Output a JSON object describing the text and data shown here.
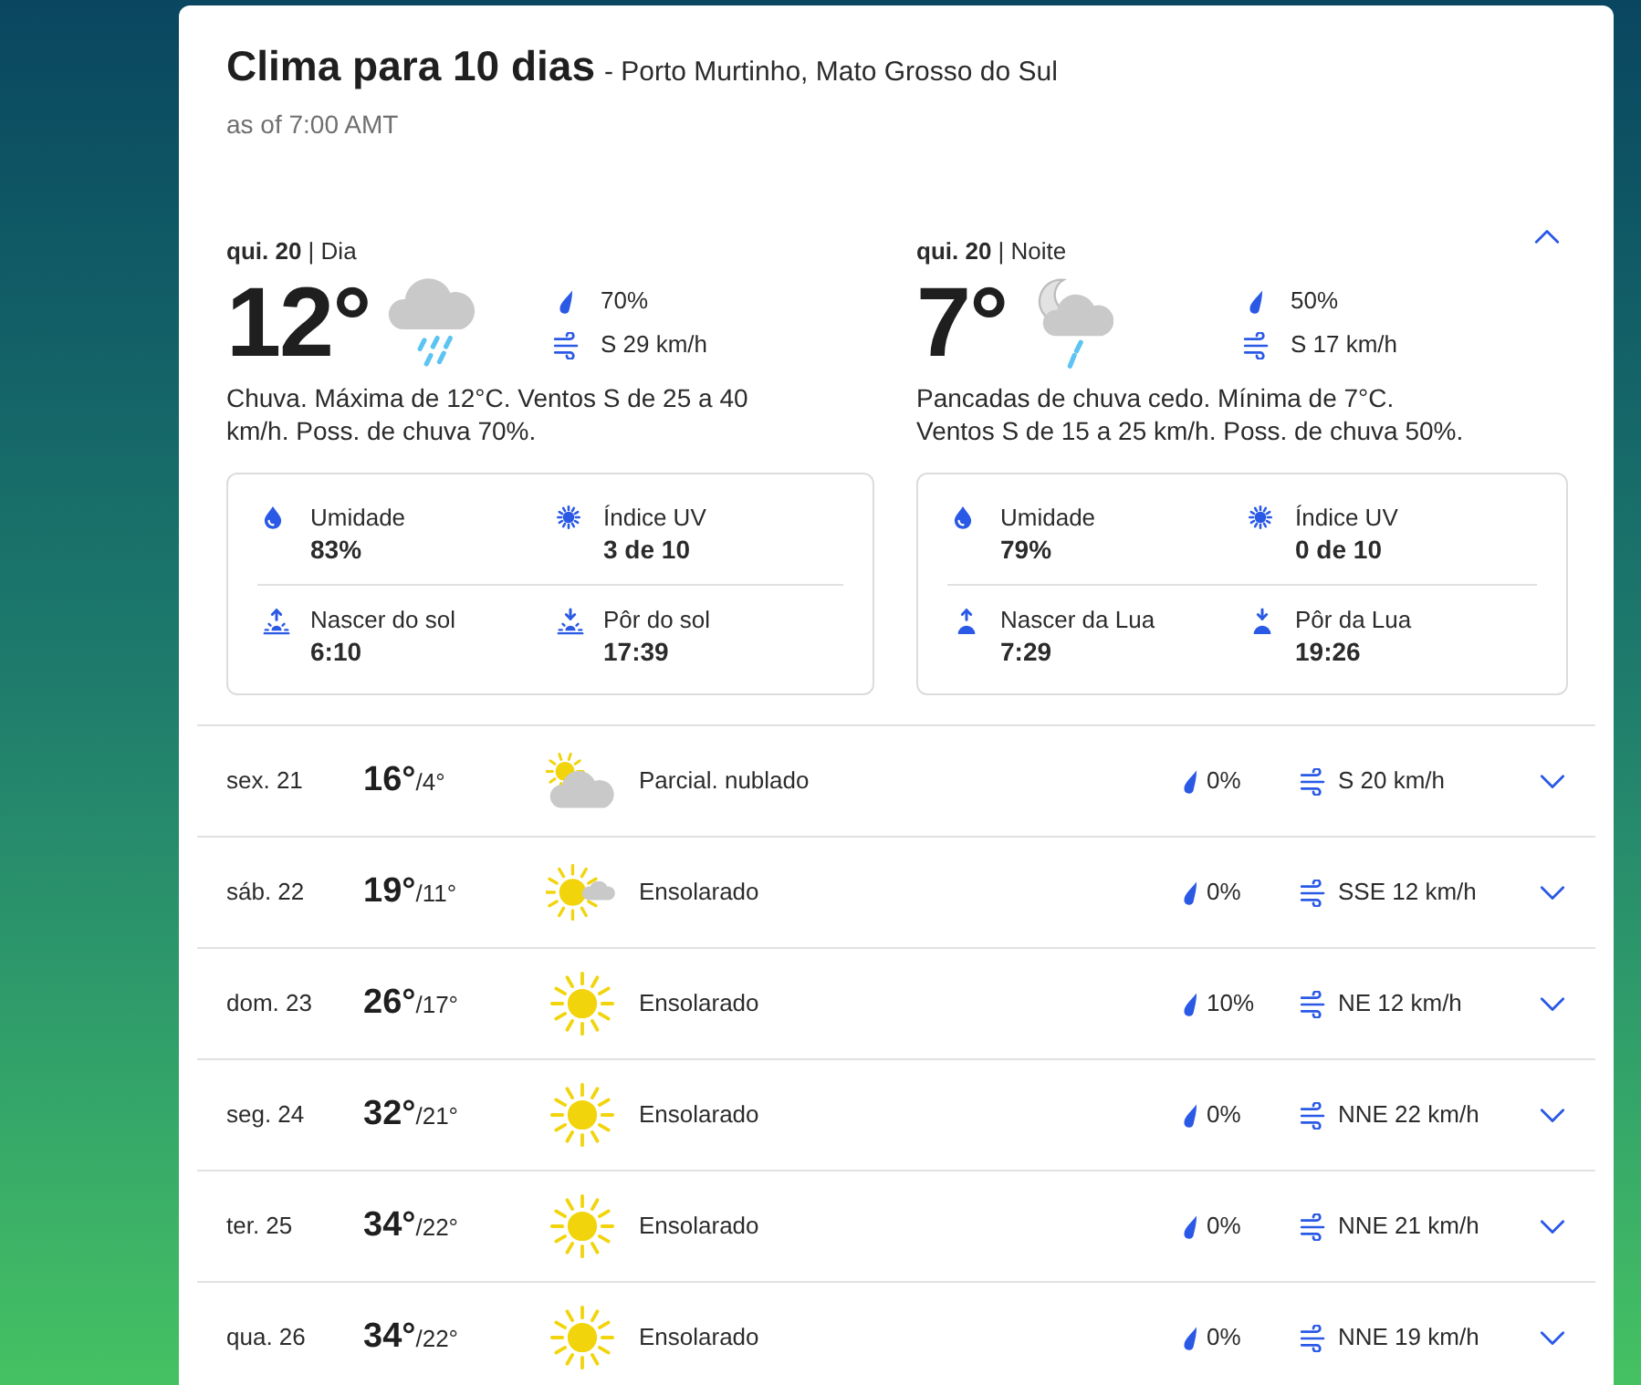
{
  "header": {
    "title": "Clima para 10 dias",
    "location": "- Porto Murtinho, Mato Grosso do Sul",
    "updated": "as of 7:00 AMT"
  },
  "today": {
    "expanded": true,
    "periods": [
      {
        "label": "**qui. 20** | Dia",
        "temp": "12°",
        "kind": "rain",
        "precip": "70%",
        "wind": "S 29 km/h",
        "description": "Chuva. Máxima de 12°C. Ventos S de 25 a 40 km/h. Poss. de chuva 70%.",
        "details": [
          {
            "kind": "humidity",
            "label": "Umidade",
            "value": "83%"
          },
          {
            "kind": "uv",
            "label": "Índice UV",
            "value": "3 de 10"
          },
          {
            "kind": "sunrise",
            "label": "Nascer do sol",
            "value": "6:10"
          },
          {
            "kind": "sunset",
            "label": "Pôr do sol",
            "value": "17:39"
          }
        ]
      },
      {
        "label": "**qui. 20** | Noite",
        "temp": "7°",
        "kind": "night-rain",
        "precip": "50%",
        "wind": "S 17 km/h",
        "description": "Pancadas de chuva cedo. Mínima de 7°C. Ventos S de 15 a 25 km/h. Poss. de chuva 50%.",
        "details": [
          {
            "kind": "humidity",
            "label": "Umidade",
            "value": "79%"
          },
          {
            "kind": "uv",
            "label": "Índice UV",
            "value": "0 de 10"
          },
          {
            "kind": "moonrise",
            "label": "Nascer da Lua",
            "value": "7:29"
          },
          {
            "kind": "moonset",
            "label": "Pôr da Lua",
            "value": "19:26"
          }
        ]
      }
    ]
  },
  "days": [
    {
      "date": "sex. 21",
      "high": "16°",
      "low": "/4°",
      "kind": "partly-cloudy",
      "condition": "Parcial. nublado",
      "precip": "0%",
      "wind": "S 20 km/h",
      "expanded": false
    },
    {
      "date": "sáb. 22",
      "high": "19°",
      "low": "/11°",
      "kind": "mostly-sunny",
      "condition": "Ensolarado",
      "precip": "0%",
      "wind": "SSE 12 km/h",
      "expanded": false
    },
    {
      "date": "dom. 23",
      "high": "26°",
      "low": "/17°",
      "kind": "sunny",
      "condition": "Ensolarado",
      "precip": "10%",
      "wind": "NE 12 km/h",
      "expanded": false
    },
    {
      "date": "seg. 24",
      "high": "32°",
      "low": "/21°",
      "kind": "sunny",
      "condition": "Ensolarado",
      "precip": "0%",
      "wind": "NNE 22 km/h",
      "expanded": false
    },
    {
      "date": "ter. 25",
      "high": "34°",
      "low": "/22°",
      "kind": "sunny",
      "condition": "Ensolarado",
      "precip": "0%",
      "wind": "NNE 21 km/h",
      "expanded": false
    },
    {
      "date": "qua. 26",
      "high": "34°",
      "low": "/22°",
      "kind": "sunny",
      "condition": "Ensolarado",
      "precip": "0%",
      "wind": "NNE 19 km/h",
      "expanded": false
    }
  ]
}
